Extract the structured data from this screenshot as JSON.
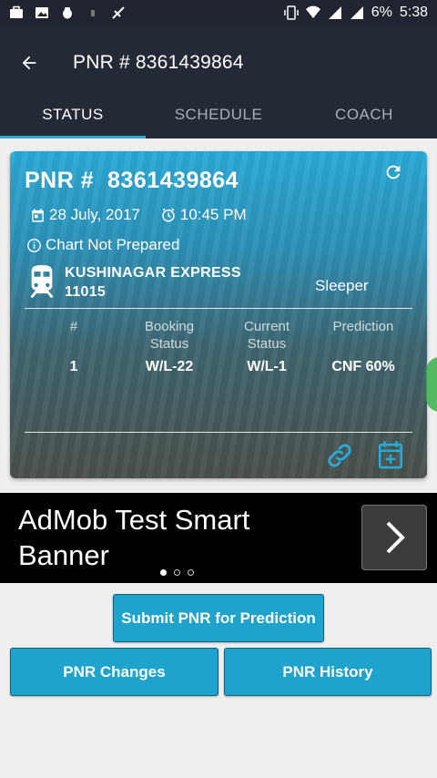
{
  "status_bar": {
    "battery": "6%",
    "time": "5:38"
  },
  "app_bar": {
    "title": "PNR # 8361439864"
  },
  "tabs": [
    {
      "label": "STATUS",
      "active": true
    },
    {
      "label": "SCHEDULE",
      "active": false
    },
    {
      "label": "COACH",
      "active": false
    }
  ],
  "card": {
    "pnr_label": "PNR #  8361439864",
    "date": "28 July, 2017",
    "time": "10:45 PM",
    "chart_status": "Chart Not Prepared",
    "train_name": "KUSHINAGAR EXPRESS",
    "train_number": "11015",
    "class": "Sleeper",
    "columns": {
      "number": "#",
      "booking_1": "Booking",
      "booking_2": "Status",
      "current_1": "Current",
      "current_2": "Status",
      "prediction": "Prediction"
    },
    "rows": [
      {
        "number": "1",
        "booking": "W/L-22",
        "current": "W/L-1",
        "prediction": "CNF 60%"
      }
    ]
  },
  "ad": {
    "text": "AdMob Test Smart Banner",
    "pager_count": 3,
    "pager_active": 0
  },
  "buttons": {
    "submit": "Submit PNR for Prediction",
    "changes": "PNR Changes",
    "history": "PNR History"
  },
  "colors": {
    "accent": "#1ea3cc",
    "appbar": "#232a36",
    "tab_indicator": "#29a9d4"
  }
}
